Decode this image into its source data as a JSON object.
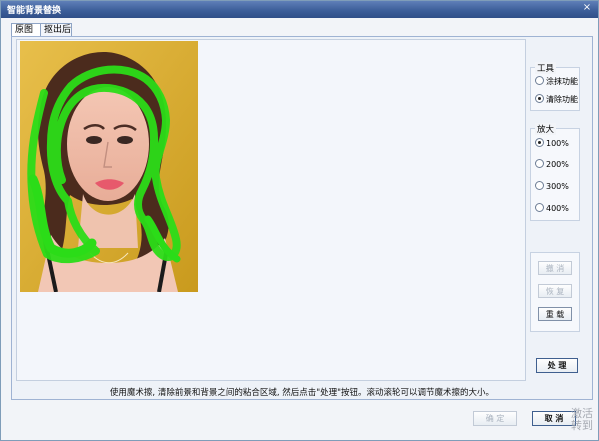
{
  "window": {
    "title": "智能背景替换",
    "close_label": "×"
  },
  "tabs": [
    {
      "label": "原图",
      "active": true
    },
    {
      "label": "抠出后",
      "active": false
    }
  ],
  "tools": {
    "group_title": "工具",
    "options": [
      "涂抹功能",
      "清除功能"
    ],
    "selected": "清除功能"
  },
  "zoom": {
    "group_title": "放大",
    "options": [
      "100%",
      "200%",
      "300%",
      "400%"
    ],
    "selected": "100%"
  },
  "actions": {
    "undo": "撤 消",
    "redo": "恢 复",
    "reset": "重 载",
    "process": "处 理"
  },
  "instruction": "使用魔术擦, 清除前景和背景之间的粘合区域, 然后点击\"处理\"按钮。滚动滚轮可以调节魔术擦的大小。",
  "footer": {
    "ok": "确 定",
    "cancel": "取 消"
  },
  "watermark": {
    "line1": "激活",
    "line2": "转到"
  },
  "colors": {
    "titlebar": "#3d5f9a",
    "mask": "#2bdc18",
    "background": "#d8ab2f"
  },
  "icons": {
    "close": "close-icon",
    "radio": "radio-icon"
  }
}
